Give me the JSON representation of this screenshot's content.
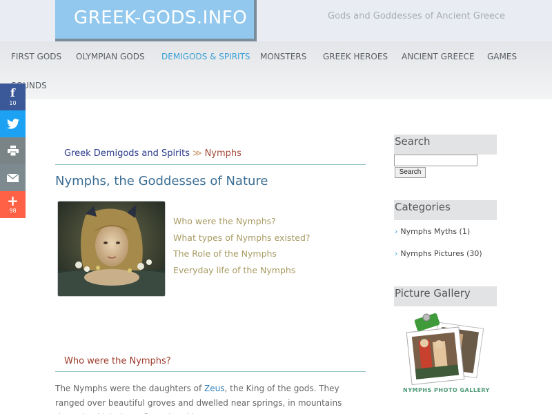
{
  "header": {
    "logo": "GREEK-GODS.INFO",
    "tagline": "Gods and Goddesses of Ancient Greece"
  },
  "nav": {
    "items": [
      {
        "label": "FIRST GODS"
      },
      {
        "label": "OLYMPIAN GODS"
      },
      {
        "label": "DEMIGODS & SPIRITS"
      },
      {
        "label": "MONSTERS"
      },
      {
        "label": "GREEK HEROES"
      },
      {
        "label": "ANCIENT GREECE"
      },
      {
        "label": "GAMES"
      },
      {
        "label": "SOUNDS"
      }
    ],
    "active": "DEMIGODS & SPIRITS"
  },
  "social": {
    "facebook": {
      "icon": "facebook-icon",
      "count": "10"
    },
    "twitter": {
      "icon": "twitter-icon"
    },
    "print": {
      "icon": "print-icon"
    },
    "email": {
      "icon": "email-icon"
    },
    "more": {
      "icon": "plus-icon",
      "count": "98"
    }
  },
  "breadcrumb": {
    "parent": "Greek Demigods and Spirits",
    "separator": "≫",
    "current": "Nymphs"
  },
  "page": {
    "title": "Nymphs, the Goddesses of Nature",
    "toc": [
      "Who were the Nymphs?",
      "What types of Nymphs existed?",
      "The Role of the Nymphs",
      "Everyday life of the Nymphs"
    ],
    "section_title": "Who were the Nymphs?",
    "body": {
      "p1_before": "The Nymphs were the daughters of ",
      "p1_link": "Zeus",
      "p1_after": ", the King of the gods. They ranged over beautiful groves and dwelled near springs, in mountains through which rivers flowed and in caves."
    }
  },
  "sidebar": {
    "search_title": "Search",
    "search_button": "Search",
    "search_placeholder": "",
    "categories_title": "Categories",
    "categories": [
      {
        "label": "Nymphs Myths (1)"
      },
      {
        "label": "Nymphs Pictures (30)"
      }
    ],
    "gallery_title": "Picture Gallery",
    "gallery_caption": "NYMPHS PHOTO GALLERY"
  },
  "colors": {
    "logo_bg": "#92c8ee",
    "nav_active": "#3aa0d6",
    "title": "#3c6e93",
    "toc_link": "#a89b63",
    "section_title": "#9b3a2a"
  }
}
